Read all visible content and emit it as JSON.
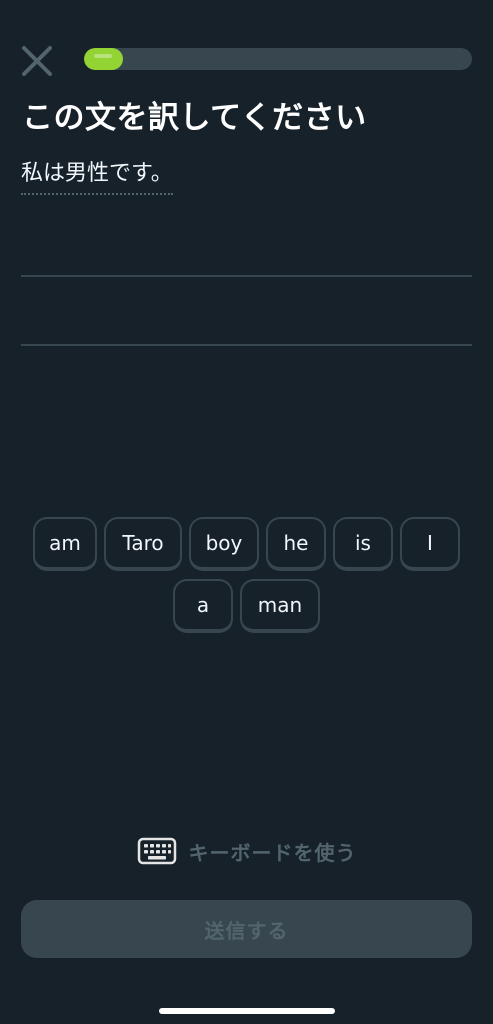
{
  "header": {
    "close_icon": "close-icon",
    "progress_fraction": 0.1
  },
  "title": "この文を訳してください",
  "prompt_sentence": "私は男性です。",
  "word_bank": [
    "am",
    "Taro",
    "boy",
    "he",
    "is",
    "I",
    "a",
    "man"
  ],
  "keyboard_toggle": {
    "icon": "keyboard-icon",
    "label": "キーボードを使う"
  },
  "submit_label": "送信する",
  "colors": {
    "background": "#17212a",
    "progress_fill": "#93d333",
    "track": "#37464f",
    "disabled_text": "#52656d"
  }
}
